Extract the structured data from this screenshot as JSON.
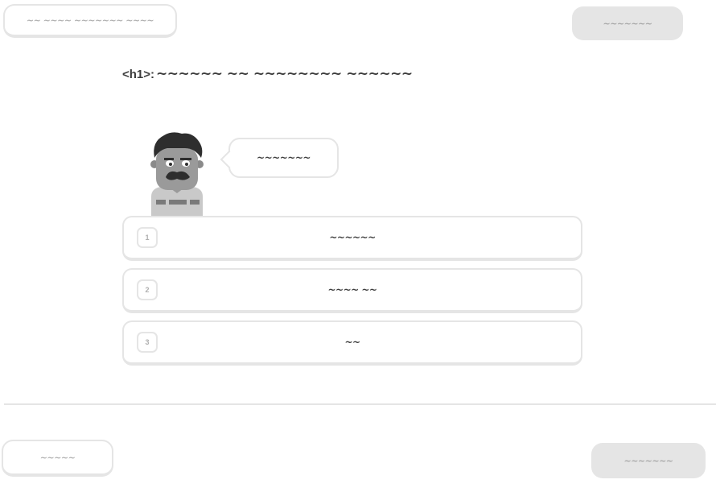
{
  "header": {
    "left_pill_label": "~~ ~~~~ ~~~~~~~ ~~~~",
    "right_button_label": "~~~~~~~"
  },
  "title": {
    "prefix": "<h1>:",
    "text": "~~~~~~ ~~ ~~~~~~~~ ~~~~~~"
  },
  "speech": {
    "text": "~~~~~~~"
  },
  "choices": [
    {
      "key": "1",
      "text": "~~~~~~"
    },
    {
      "key": "2",
      "text": "~~~~ ~~"
    },
    {
      "key": "3",
      "text": "~~"
    }
  ],
  "footer": {
    "skip_label": "~~~~~",
    "check_label": "~~~~~~~"
  },
  "colors": {
    "border": "#e5e5e5",
    "disabled_button": "#e5e5e5",
    "text_dark": "#3c3c3c",
    "text_muted": "#afafaf"
  }
}
